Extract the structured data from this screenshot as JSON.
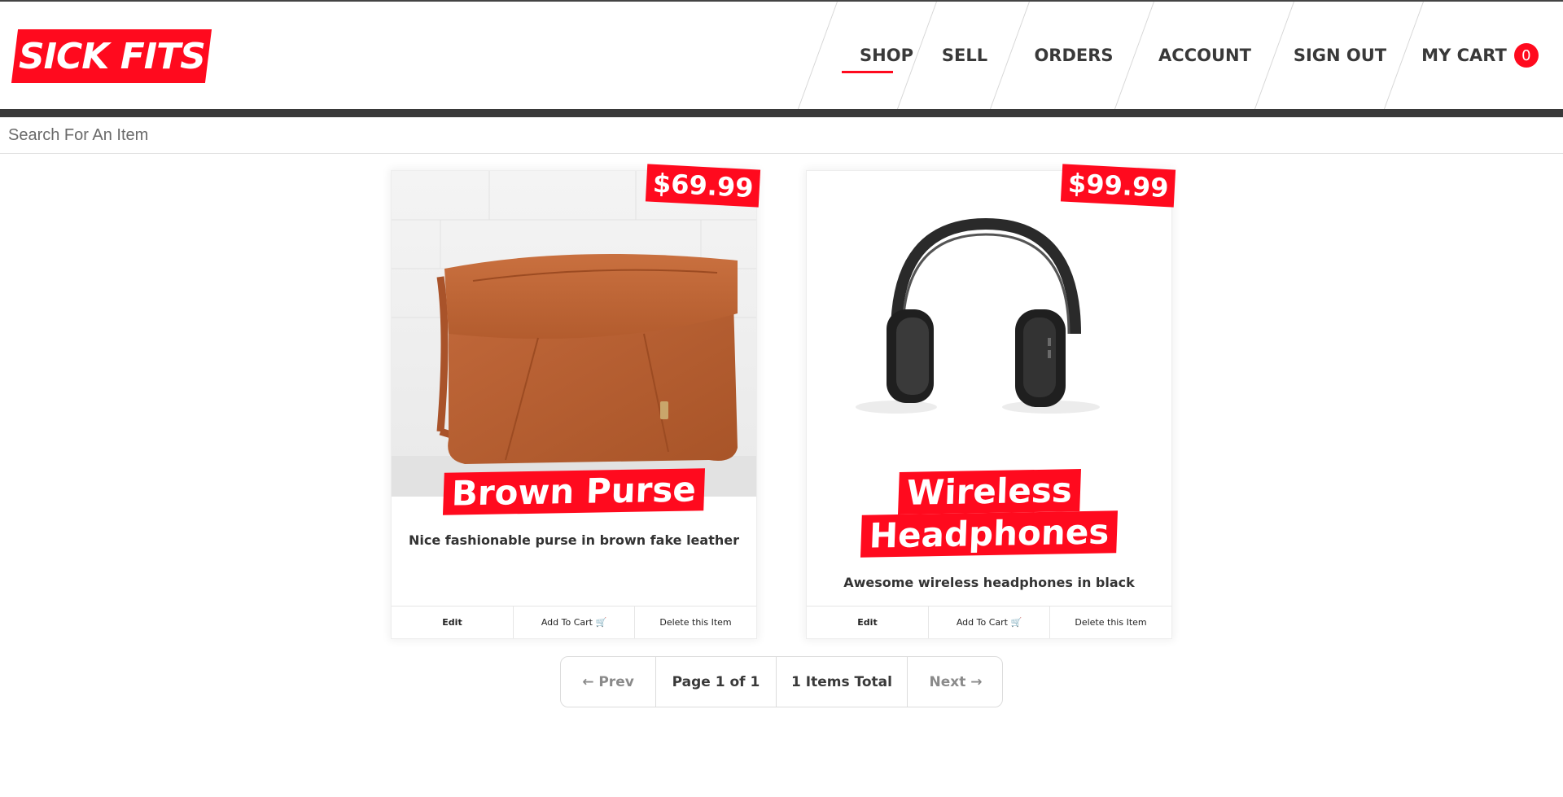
{
  "header": {
    "logo_text": "SICK FITS",
    "nav": {
      "shop": "SHOP",
      "sell": "SELL",
      "orders": "ORDERS",
      "account": "ACCOUNT",
      "sign_out": "SIGN OUT",
      "cart": "MY CART",
      "cart_count": "0"
    },
    "active_item": "SHOP"
  },
  "search": {
    "placeholder": "Search For An Item"
  },
  "items": [
    {
      "price": "$69.99",
      "title_lines": [
        "Brown Purse"
      ],
      "description": "Nice fashionable purse in brown fake leather",
      "actions": {
        "edit": "Edit",
        "add_to_cart": "Add To Cart 🛒",
        "delete": "Delete this Item"
      }
    },
    {
      "price": "$99.99",
      "title_lines": [
        "Wireless",
        "Headphones"
      ],
      "description": "Awesome wireless headphones in black",
      "actions": {
        "edit": "Edit",
        "add_to_cart": "Add To Cart 🛒",
        "delete": "Delete this Item"
      }
    }
  ],
  "pagination": {
    "prev": "← Prev",
    "page": "Page 1 of 1",
    "total": "1 Items Total",
    "next": "Next →"
  },
  "colors": {
    "brand": "#ff0a1e",
    "text": "#393939",
    "header_bar": "#393939"
  }
}
